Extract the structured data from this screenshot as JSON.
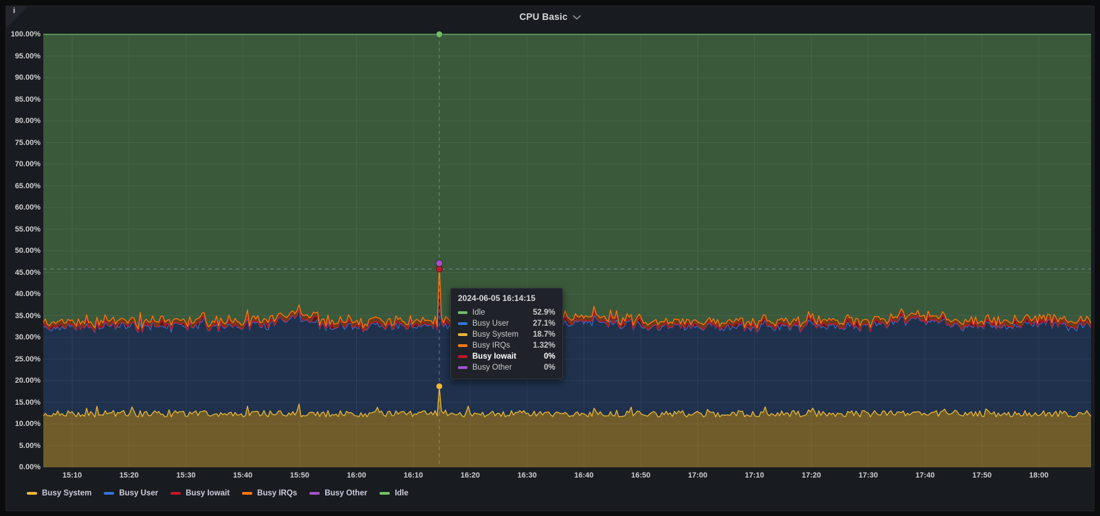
{
  "panel": {
    "title": "CPU Basic",
    "info_icon": "i"
  },
  "tooltip": {
    "timestamp": "2024-06-05 16:14:15",
    "rows": [
      {
        "label": "Idle",
        "value": "52.9%",
        "color": "#73BF69",
        "bold": false
      },
      {
        "label": "Busy User",
        "value": "27.1%",
        "color": "#3274D9",
        "bold": false
      },
      {
        "label": "Busy System",
        "value": "18.7%",
        "color": "#EAB839",
        "bold": false
      },
      {
        "label": "Busy IRQs",
        "value": "1.32%",
        "color": "#FF780A",
        "bold": false
      },
      {
        "label": "Busy Iowait",
        "value": "0%",
        "color": "#C4162A",
        "bold": true
      },
      {
        "label": "Busy Other",
        "value": "0%",
        "color": "#A352CC",
        "bold": false
      }
    ]
  },
  "legend": {
    "items": [
      {
        "label": "Busy System",
        "color": "#EAB839"
      },
      {
        "label": "Busy User",
        "color": "#3274D9"
      },
      {
        "label": "Busy Iowait",
        "color": "#C4162A"
      },
      {
        "label": "Busy IRQs",
        "color": "#FF780A"
      },
      {
        "label": "Busy Other",
        "color": "#A352CC"
      },
      {
        "label": "Idle",
        "color": "#73BF69"
      }
    ]
  },
  "chart_data": {
    "type": "area",
    "stacked": true,
    "title": "CPU Basic",
    "unit": "percent",
    "ylim": [
      0,
      100
    ],
    "y_tick_labels": [
      "100.00%",
      "95.00%",
      "90.00%",
      "85.00%",
      "80.00%",
      "75.00%",
      "70.00%",
      "65.00%",
      "60.00%",
      "55.00%",
      "50.00%",
      "45.00%",
      "40.00%",
      "35.00%",
      "30.00%",
      "25.00%",
      "20.00%",
      "15.00%",
      "10.00%",
      "5.00%",
      "0.00%"
    ],
    "x_ticks": [
      "15:10",
      "15:20",
      "15:30",
      "15:40",
      "15:50",
      "16:00",
      "16:10",
      "16:20",
      "16:30",
      "16:40",
      "16:50",
      "17:00",
      "17:10",
      "17:20",
      "17:30",
      "17:40",
      "17:50",
      "18:00"
    ],
    "series": [
      {
        "name": "Busy System",
        "color": "#EAB839",
        "fill_opacity": 0.42,
        "baseline_pct": 12.0,
        "noise_pct": 1.5,
        "value_at_cursor_pct": 18.7
      },
      {
        "name": "Busy User",
        "color": "#3274D9",
        "fill_opacity": 0.25,
        "baseline_pct": 19.5,
        "noise_pct": 1.3,
        "value_at_cursor_pct": 27.1
      },
      {
        "name": "Busy Iowait",
        "color": "#C4162A",
        "fill_opacity": 0.35,
        "baseline_pct": 0.3,
        "noise_pct": 1.2,
        "value_at_cursor_pct": 0
      },
      {
        "name": "Busy IRQs",
        "color": "#FF780A",
        "fill_opacity": 0.35,
        "baseline_pct": 0.9,
        "noise_pct": 0.45,
        "value_at_cursor_pct": 1.32
      },
      {
        "name": "Busy Other",
        "color": "#A352CC",
        "fill_opacity": 0.35,
        "baseline_pct": 0.0,
        "noise_pct": 0.0,
        "value_at_cursor_pct": 0
      },
      {
        "name": "Idle",
        "color": "#73BF69",
        "fill_opacity": 0.38,
        "baseline_pct": 67.3,
        "noise_pct": 0.0,
        "value_at_cursor_pct": 52.9,
        "stack_remainder_to": 100
      }
    ],
    "cursor": {
      "timestamp": "2024-06-05 16:14:15",
      "x_fraction": 0.3773,
      "crosshair_y_pct": 45.8
    }
  }
}
